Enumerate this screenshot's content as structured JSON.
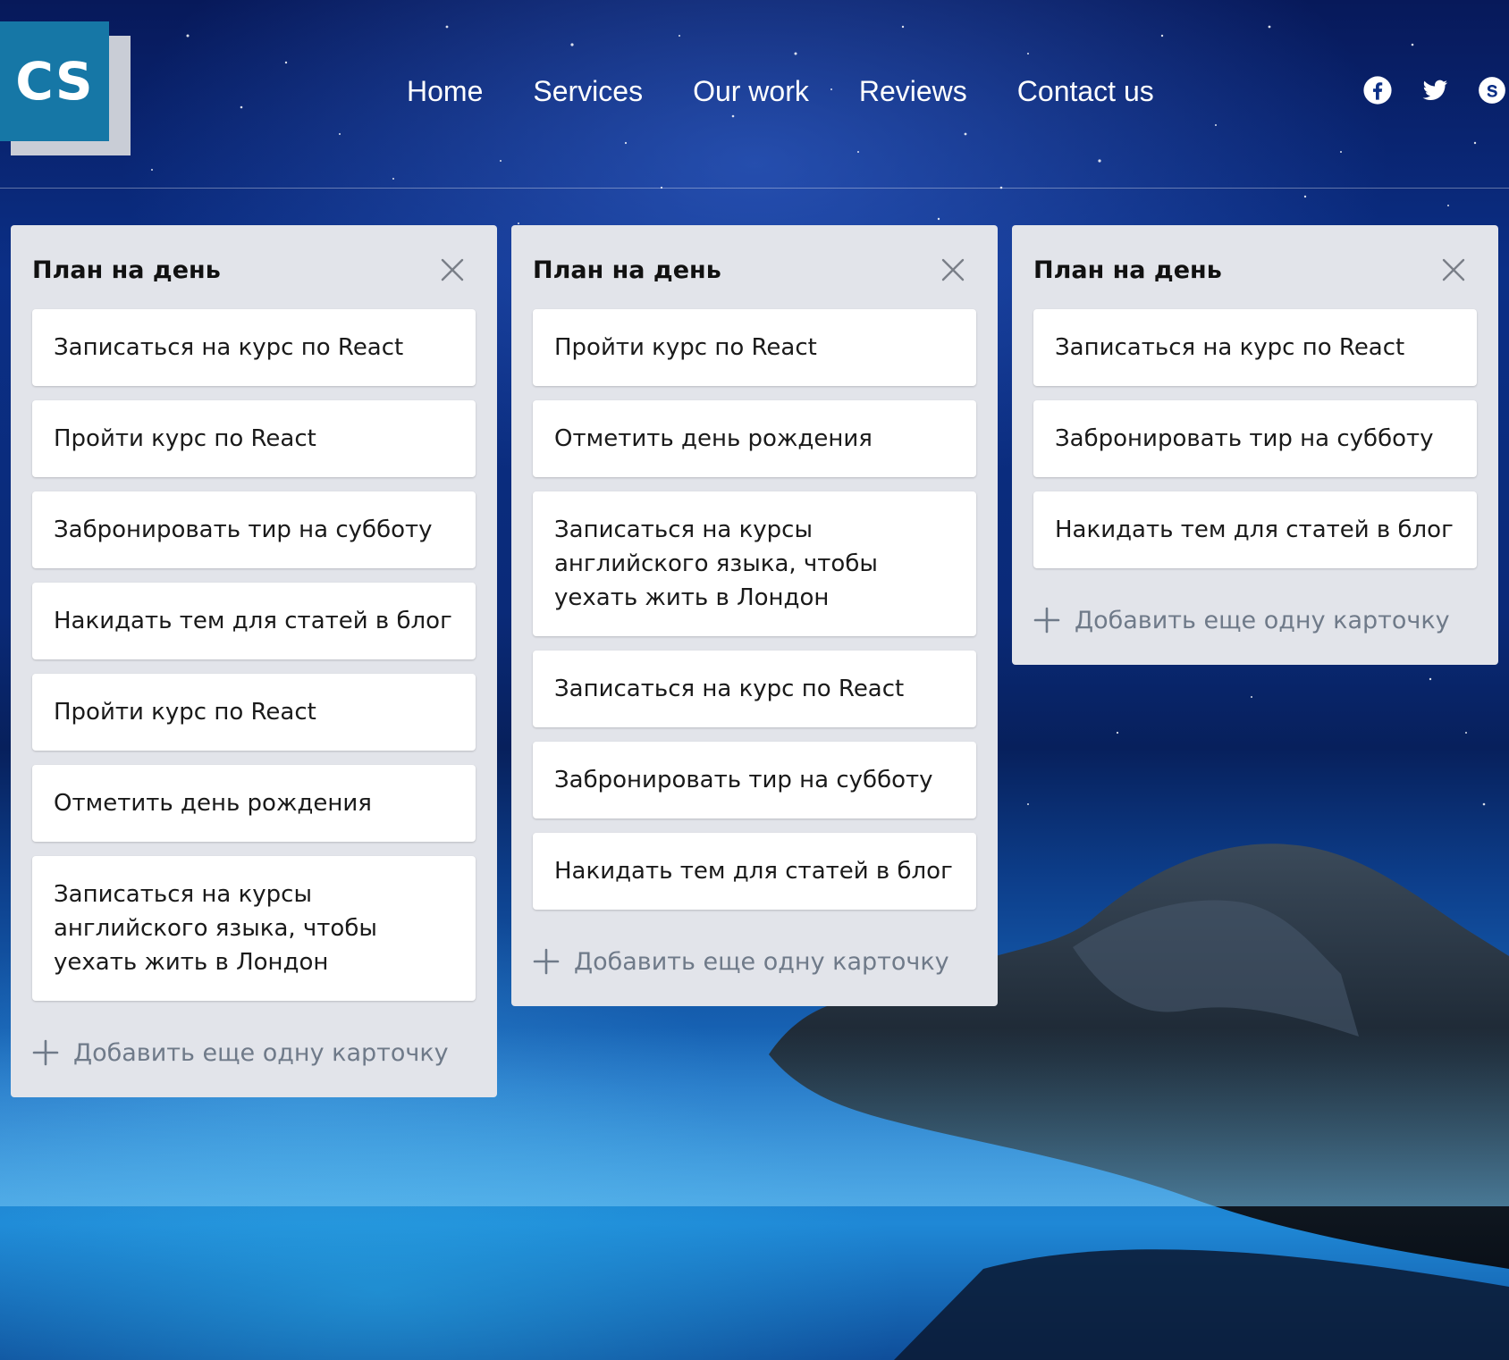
{
  "logo": {
    "text": "CS"
  },
  "nav": {
    "items": [
      {
        "label": "Home"
      },
      {
        "label": "Services"
      },
      {
        "label": "Our work"
      },
      {
        "label": "Reviews"
      },
      {
        "label": "Contact us"
      }
    ]
  },
  "social": {
    "icons": [
      "facebook-icon",
      "twitter-icon",
      "skype-icon"
    ]
  },
  "board": {
    "columns": [
      {
        "title": "План на день",
        "cards": [
          "Записаться на курс по React",
          "Пройти курс по React",
          "Забронировать тир на субботу",
          "Накидать тем для статей в блог",
          "Пройти курс по React",
          "Отметить день рождения",
          "Записаться на курсы английского языка, чтобы уехать жить в Лондон"
        ],
        "add_label": "Добавить еще одну карточку"
      },
      {
        "title": "План на день",
        "cards": [
          "Пройти курс по React",
          "Отметить день рождения",
          "Записаться на курсы английского языка, чтобы уехать жить в Лондон",
          "Записаться на курс по React",
          "Забронировать тир на субботу",
          "Накидать тем для статей в блог"
        ],
        "add_label": "Добавить еще одну карточку"
      },
      {
        "title": "План на день",
        "cards": [
          "Записаться на курс по React",
          "Забронировать тир на субботу",
          "Накидать тем для статей в блог"
        ],
        "add_label": "Добавить еще одну карточку"
      }
    ]
  },
  "colors": {
    "logo_bg": "#1677a6",
    "logo_shadow": "#c9cdd6",
    "column_bg": "#e2e4ea",
    "card_bg": "#ffffff",
    "add_text": "#6f7a89"
  }
}
